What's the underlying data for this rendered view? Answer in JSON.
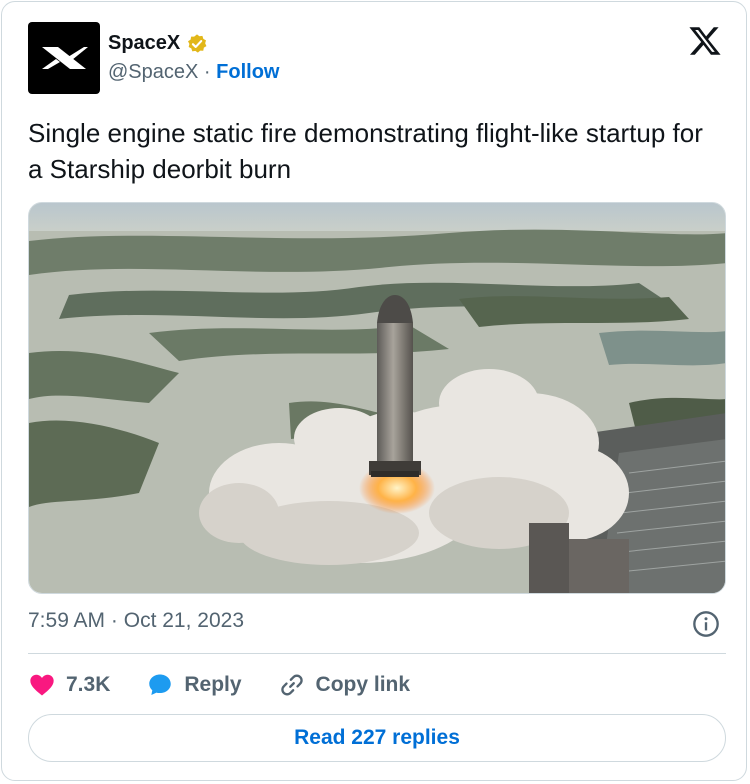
{
  "author": {
    "name": "SpaceX",
    "handle": "@SpaceX",
    "separator": "·",
    "follow_label": "Follow",
    "verified_icon": "verified-badge-gold"
  },
  "tweet": {
    "text": "Single engine static fire demonstrating flight-like startup for a Starship deorbit burn",
    "time": "7:59 AM",
    "separator": "·",
    "date": "Oct 21, 2023"
  },
  "actions": {
    "likes": "7.3K",
    "reply_label": "Reply",
    "copy_link_label": "Copy link"
  },
  "read_replies_label": "Read 227 replies",
  "colors": {
    "like": "#f91880",
    "link": "#006fd6",
    "muted": "#536471",
    "border": "#cfd9de",
    "verified": "#e2b719"
  }
}
